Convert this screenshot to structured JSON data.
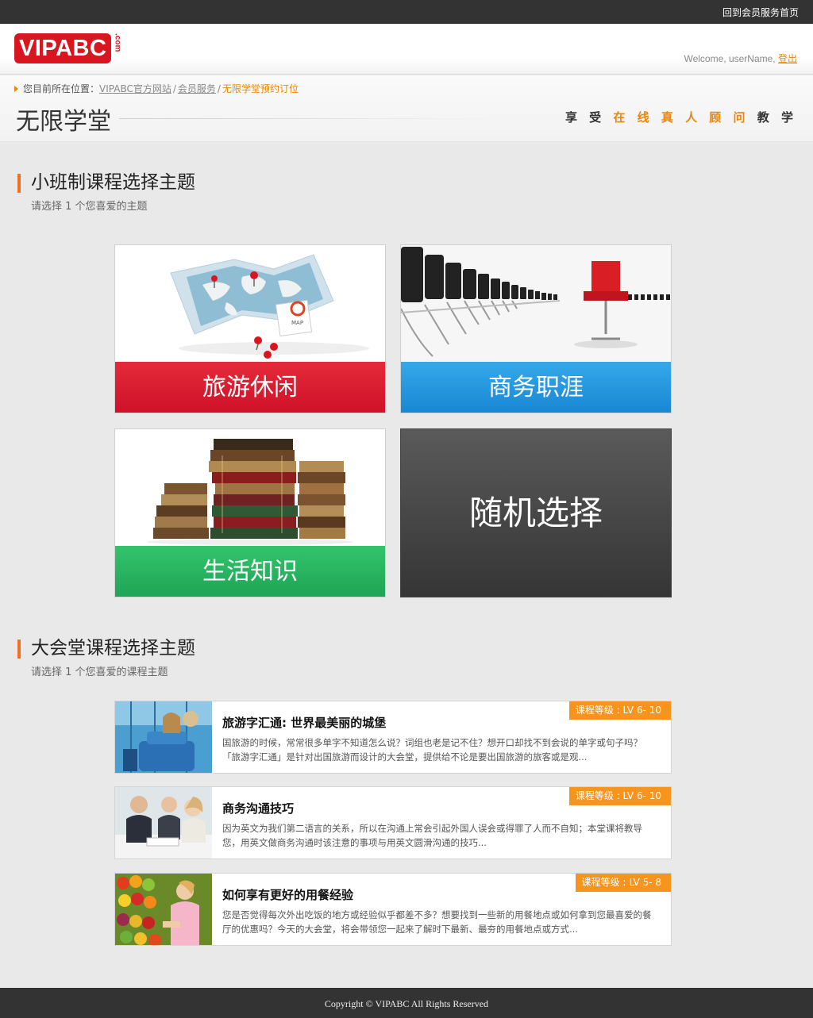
{
  "topbar": {
    "link": "回到会员服务首页"
  },
  "header": {
    "logo_text": "VIPABC",
    "logo_suffix": ".com",
    "welcome": "Welcome, userName,",
    "logout": "登出"
  },
  "breadcrumb": {
    "prefix": "您目前所在位置：",
    "items": [
      "VIPABC官方网站",
      "会员服务",
      "无限学堂预约订位"
    ],
    "separator": "/"
  },
  "page": {
    "title": "无限学堂",
    "slogan_a": "享 受",
    "slogan_b": "在 线 真 人 顾 问",
    "slogan_c": "教 学"
  },
  "small_class": {
    "title": "小班制课程选择主题",
    "subtitle": "请选择 1 个您喜爱的主题",
    "tiles": [
      {
        "label": "旅游休闲"
      },
      {
        "label": "商务职涯"
      },
      {
        "label": "生活知识"
      },
      {
        "label": "随机选择"
      }
    ],
    "map_text": "MAP"
  },
  "lecture": {
    "title": "大会堂课程选择主题",
    "subtitle": "请选择 1 个您喜爱的课程主题",
    "courses": [
      {
        "level": "课程等级 : LV 6- 10",
        "title": "旅游字汇通: 世界最美丽的城堡",
        "desc": "国旅游的时候，常常很多单字不知道怎么说？词组也老是记不住？想开口却找不到会说的单字或句子吗？「旅游字汇通」是针对出国旅游而设计的大会堂，提供给不论是要出国旅游的旅客或是观..."
      },
      {
        "level": "课程等级 : LV 6- 10",
        "title": "商务沟通技巧",
        "desc": "因为英文为我们第二语言的关系，所以在沟通上常会引起外国人误会或得罪了人而不自知；本堂课将教导您，用英文做商务沟通时该注意的事项与用英文圆滑沟通的技巧..."
      },
      {
        "level": "课程等级 : LV 5- 8",
        "title": "如何享有更好的用餐经验",
        "desc": "您是否觉得每次外出吃饭的地方或经验似乎都差不多？想要找到一些新的用餐地点或如何拿到您最喜爱的餐厅的优惠吗？今天的大会堂，将会带领您一起来了解时下最新、最夯的用餐地点或方式..."
      }
    ]
  },
  "footer": {
    "copyright": "Copyright © VIPABC All Rights Reserved"
  },
  "colors": {
    "brand_red": "#d9161f",
    "accent_orange": "#e8870d",
    "travel_red": "#cf1128",
    "business_blue": "#1887d3",
    "life_green": "#1ea455"
  }
}
